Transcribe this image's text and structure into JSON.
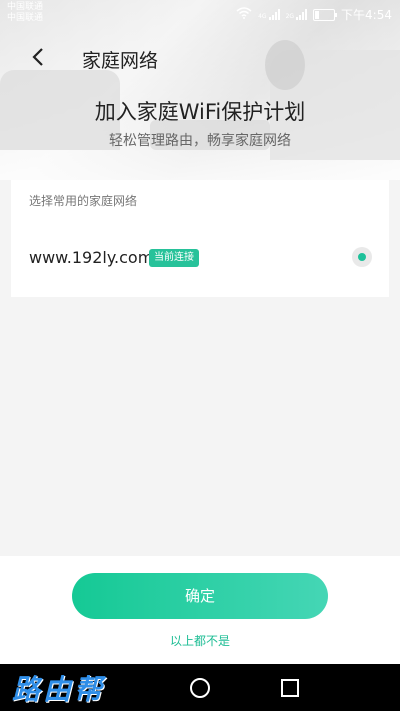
{
  "status_bar": {
    "carrier_1": "中国联通",
    "carrier_2": "中国联通",
    "network_1": "4G",
    "network_2": "2G",
    "time": "下午4:54"
  },
  "nav": {
    "title": "家庭网络",
    "back_icon": "chevron-left-icon"
  },
  "header": {
    "headline": "加入家庭WiFi保护计划",
    "subline": "轻松管理路由，畅享家庭网络"
  },
  "networks": {
    "label": "选择常用的家庭网络",
    "items": [
      {
        "name": "www.192ly.com",
        "badge": "当前连接",
        "selected": true
      }
    ]
  },
  "actions": {
    "confirm_label": "确定",
    "none_label": "以上都不是"
  },
  "system_nav": {
    "logo_text": "路由帮"
  },
  "colors": {
    "accent": "#1dc19a",
    "badge": "#27c29a",
    "button_start": "#15c995",
    "button_end": "#45d6b5"
  }
}
